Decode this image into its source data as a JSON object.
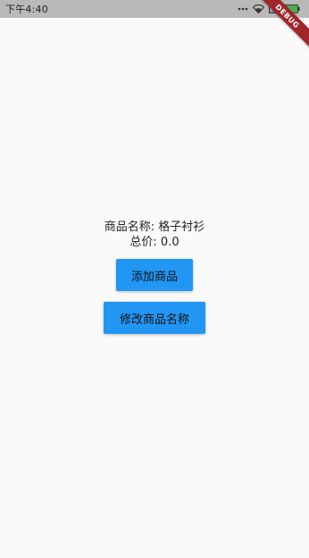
{
  "status_bar": {
    "time": "下午4:40",
    "icons": [
      "more-dots-icon",
      "wifi-icon",
      "sim-icon",
      "battery-icon"
    ]
  },
  "debug_banner": {
    "label": "DEBUG"
  },
  "product": {
    "name_label": "商品名称: 格子衬衫",
    "total_label": "总价: 0.0"
  },
  "buttons": {
    "add_product": "添加商品",
    "edit_name": "修改商品名称"
  },
  "colors": {
    "button": "#2196f3",
    "status_bar": "#b9b9b9",
    "debug_banner": "#a0262b",
    "battery_fill": "#4caf50"
  }
}
